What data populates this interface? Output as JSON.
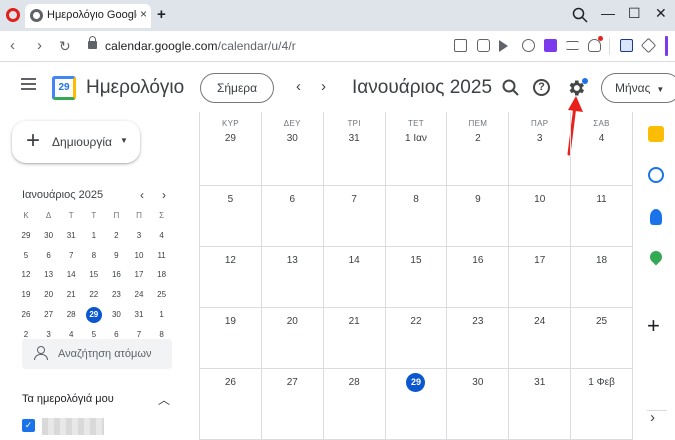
{
  "browser": {
    "tab_title": "Ημερολόγιο Google - Ιαν",
    "tab_close": "×",
    "new_tab": "+",
    "url_host": "calendar.google.com",
    "url_path": "/calendar/u/4/r",
    "window_controls": {
      "minimize": "—",
      "maximize": "☐",
      "close": "✕"
    },
    "nav": {
      "back": "‹",
      "forward": "›",
      "reload": "↻"
    }
  },
  "header": {
    "app_name": "Ημερολόγιο",
    "logo_day": "29",
    "today_button": "Σήμερα",
    "prev": "‹",
    "next": "›",
    "month_title": "Ιανουάριος 2025",
    "view_selector": "Μήνας",
    "icons": [
      "search-icon",
      "help-icon",
      "settings-gear-icon"
    ]
  },
  "sidebar": {
    "create_label": "Δημιουργία",
    "mini_calendar": {
      "title": "Ιανουάριος 2025",
      "weekday_heads": [
        "Κ",
        "Δ",
        "Τ",
        "Τ",
        "Π",
        "Π",
        "Σ"
      ],
      "weeks": [
        [
          "29",
          "30",
          "31",
          "1",
          "2",
          "3",
          "4"
        ],
        [
          "5",
          "6",
          "7",
          "8",
          "9",
          "10",
          "11"
        ],
        [
          "12",
          "13",
          "14",
          "15",
          "16",
          "17",
          "18"
        ],
        [
          "19",
          "20",
          "21",
          "22",
          "23",
          "24",
          "25"
        ],
        [
          "26",
          "27",
          "28",
          "29",
          "30",
          "31",
          "1"
        ],
        [
          "2",
          "3",
          "4",
          "5",
          "6",
          "7",
          "8"
        ]
      ],
      "today": "29"
    },
    "people_search_placeholder": "Αναζήτηση ατόμων",
    "my_calendars_title": "Τα ημερολόγιά μου"
  },
  "month_grid": {
    "weekdays": [
      "ΚΥΡ",
      "ΔΕΥ",
      "ΤΡΙ",
      "ΤΕΤ",
      "ΠΕΜ",
      "ΠΑΡ",
      "ΣΑΒ"
    ],
    "weeks": [
      [
        "29",
        "30",
        "31",
        "1 Ιαν",
        "2",
        "3",
        "4"
      ],
      [
        "5",
        "6",
        "7",
        "8",
        "9",
        "10",
        "11"
      ],
      [
        "12",
        "13",
        "14",
        "15",
        "16",
        "17",
        "18"
      ],
      [
        "19",
        "20",
        "21",
        "22",
        "23",
        "24",
        "25"
      ],
      [
        "26",
        "27",
        "28",
        "29",
        "30",
        "31",
        "1 Φεβ"
      ]
    ],
    "today": "29"
  },
  "side_panel": {
    "icons": [
      "keep-icon",
      "tasks-icon",
      "contacts-icon",
      "maps-icon",
      "add-icon",
      "expand-chevron-icon"
    ],
    "add_label": "+",
    "expand_label": "›"
  },
  "colors": {
    "accent": "#0b57d0",
    "annotation_arrow": "#e8221b"
  }
}
